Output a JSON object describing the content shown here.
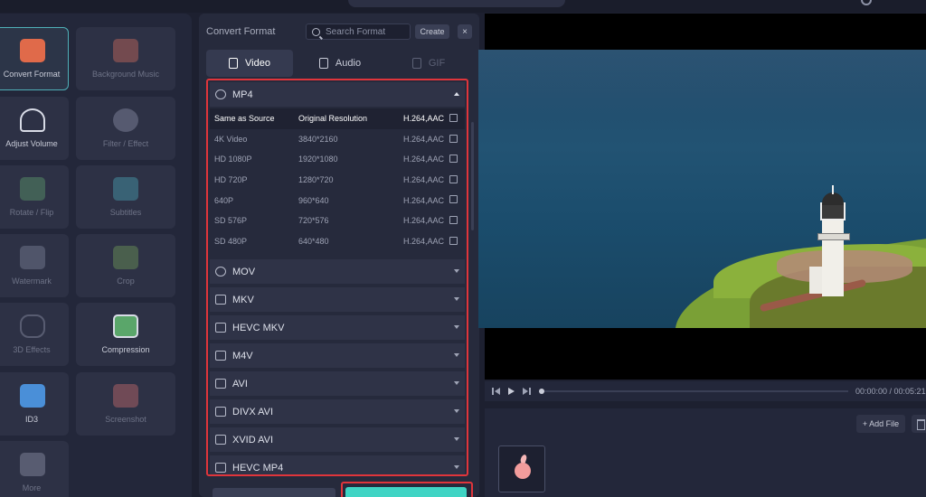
{
  "tools": [
    {
      "label": "Convert Format",
      "icon": "convert-format-icon",
      "active": true
    },
    {
      "label": "Background Music",
      "icon": "music-icon",
      "dim": true
    },
    {
      "label": "Adjust Volume",
      "icon": "volume-icon"
    },
    {
      "label": "Filter / Effect",
      "icon": "filter-icon",
      "dim": true
    },
    {
      "label": "Rotate / Flip",
      "icon": "rotate-icon",
      "dim": true
    },
    {
      "label": "Subtitles",
      "icon": "subtitles-icon",
      "dim": true
    },
    {
      "label": "Watermark",
      "icon": "watermark-icon",
      "dim": true
    },
    {
      "label": "Crop",
      "icon": "crop-icon",
      "dim": true
    },
    {
      "label": "3D Effects",
      "icon": "3d-glasses-icon",
      "dim": true
    },
    {
      "label": "Compression",
      "icon": "compression-icon"
    },
    {
      "label": "ID3",
      "icon": "id3-icon"
    },
    {
      "label": "Screenshot",
      "icon": "screenshot-icon",
      "dim": true
    },
    {
      "label": "More",
      "icon": "more-icon",
      "dim": true
    }
  ],
  "format_panel": {
    "title": "Convert Format",
    "search_placeholder": "Search Format",
    "create_label": "Create",
    "close_label": "×",
    "tabs": [
      {
        "label": "Video",
        "state": "active"
      },
      {
        "label": "Audio",
        "state": "normal"
      },
      {
        "label": "GIF",
        "state": "disabled"
      }
    ],
    "expanded_group": "MP4",
    "presets": [
      {
        "name": "Same as Source",
        "resolution": "Original Resolution",
        "codec": "H.264,AAC",
        "selected": true
      },
      {
        "name": "4K Video",
        "resolution": "3840*2160",
        "codec": "H.264,AAC"
      },
      {
        "name": "HD 1080P",
        "resolution": "1920*1080",
        "codec": "H.264,AAC"
      },
      {
        "name": "HD 720P",
        "resolution": "1280*720",
        "codec": "H.264,AAC"
      },
      {
        "name": "640P",
        "resolution": "960*640",
        "codec": "H.264,AAC"
      },
      {
        "name": "SD 576P",
        "resolution": "720*576",
        "codec": "H.264,AAC"
      },
      {
        "name": "SD 480P",
        "resolution": "640*480",
        "codec": "H.264,AAC"
      }
    ],
    "collapsed_groups": [
      "MOV",
      "MKV",
      "HEVC MKV",
      "M4V",
      "AVI",
      "DIVX AVI",
      "XVID AVI",
      "HEVC MP4"
    ]
  },
  "player": {
    "time": "00:00:00 / 00:05:21"
  },
  "files": {
    "add_file_label": "+ Add File"
  },
  "colors": {
    "highlight_border": "#e0353b",
    "accent": "#3fd4c4",
    "active_tool_border": "#4fb0b8"
  }
}
